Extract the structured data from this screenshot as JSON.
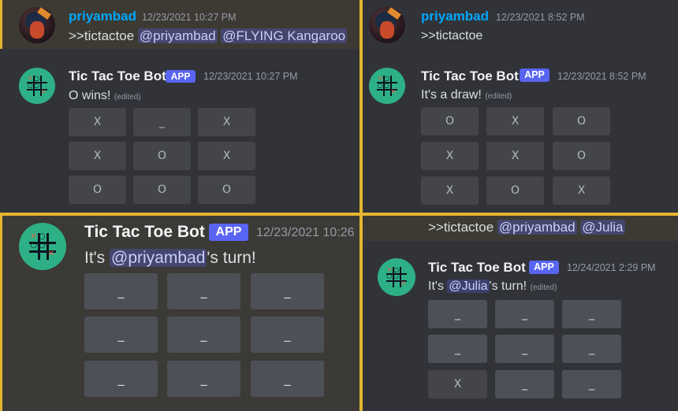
{
  "panel1": {
    "user": {
      "name": "priyambad",
      "timestamp": "12/23/2021 10:27 PM"
    },
    "command": {
      "prefix": ">>tictactoe",
      "mention1": "@priyambad",
      "mention2": "@FLYING Kangaroo"
    },
    "bot": {
      "name": "Tic Tac Toe Bot",
      "badge": "APP",
      "timestamp": "12/23/2021 10:27 PM",
      "message": "O wins!",
      "edited": "(edited)"
    },
    "board": [
      "X",
      "_",
      "X",
      "X",
      "O",
      "X",
      "O",
      "O",
      "O"
    ]
  },
  "panel2": {
    "user": {
      "name": "priyambad",
      "timestamp": "12/23/2021 8:52 PM"
    },
    "command": {
      "prefix": ">>tictactoe"
    },
    "bot": {
      "name": "Tic Tac Toe Bot",
      "badge": "APP",
      "timestamp": "12/23/2021 8:52 PM",
      "message": "It's a draw!",
      "edited": "(edited)"
    },
    "board": [
      "O",
      "X",
      "O",
      "X",
      "X",
      "O",
      "X",
      "O",
      "X"
    ]
  },
  "panel3": {
    "bot": {
      "name": "Tic Tac Toe Bot",
      "badge": "APP",
      "timestamp": "12/23/2021 10:26",
      "message_prefix": "It's ",
      "mention": "@priyambad",
      "message_suffix": "'s turn!"
    },
    "board": [
      "_",
      "_",
      "_",
      "_",
      "_",
      "_",
      "_",
      "_",
      "_"
    ]
  },
  "panel4": {
    "command": {
      "prefix": ">>tictactoe",
      "mention1": "@priyambad",
      "mention2": "@Julia"
    },
    "bot": {
      "name": "Tic Tac Toe Bot",
      "badge": "APP",
      "timestamp": "12/24/2021 2:29 PM",
      "message_prefix": "It's ",
      "mention": "@Julia",
      "message_suffix": "'s turn!",
      "edited": "(edited)"
    },
    "board": [
      "_",
      "_",
      "_",
      "_",
      "_",
      "_",
      "X",
      "_",
      "_"
    ]
  },
  "colors": {
    "accent": "#5865f2",
    "highlight_border": "#e6b530",
    "username": "#00a8fc",
    "bot_avatar": "#2eb086",
    "background": "#313338"
  },
  "icons": {
    "user_avatar": "user-avatar",
    "bot_avatar": "tic-tac-toe-bot-avatar-icon"
  }
}
